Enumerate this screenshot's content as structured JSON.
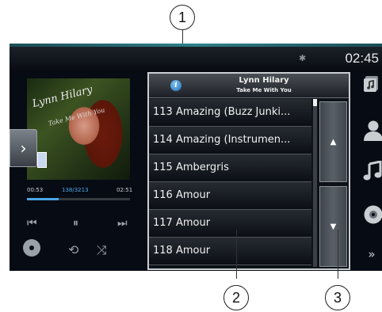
{
  "callouts": [
    "1",
    "2",
    "3"
  ],
  "status": {
    "clock": "02:45",
    "bluetooth_icon": "bluetooth-icon"
  },
  "album_art": {
    "title_script": "Lynn Hilary",
    "subtitle_script": "Take Me With You"
  },
  "playback": {
    "elapsed": "00:53",
    "track_counter": "138/3213",
    "duration": "02:51",
    "progress": 0.31
  },
  "controls": {
    "prev": "⏮",
    "pause": "⏸",
    "next": "⏭",
    "repeat": "⟲",
    "shuffle": "⤨"
  },
  "list_header": {
    "artist": "Lynn Hilary",
    "album": "Take Me With You",
    "info": "i"
  },
  "tracks": [
    "113 Amazing (Buzz Junki...",
    "114 Amazing (Instrumen...",
    "115 Ambergris",
    "116 Amour",
    "117 Amour",
    "118 Amour"
  ],
  "scroll_buttons": {
    "up": "▲",
    "down": "▼"
  },
  "side_menu": [
    "music-library-icon",
    "artist-icon",
    "music-note-icon",
    "disc-icon",
    "more-icon"
  ],
  "colors": {
    "accent_blue": "#4aa6e6",
    "list_border": "#c9ced3",
    "background": "#060b14"
  }
}
